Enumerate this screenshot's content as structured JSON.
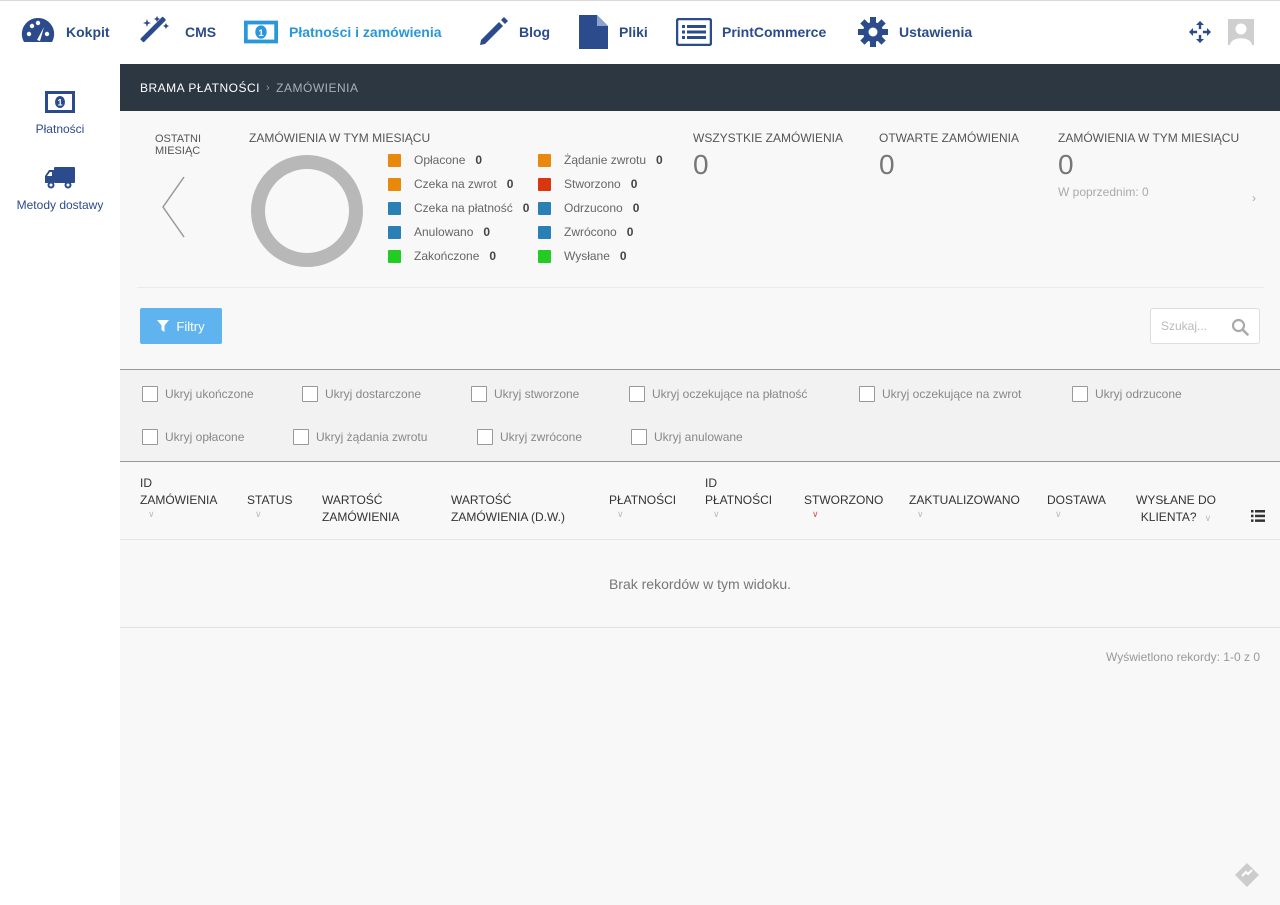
{
  "nav": {
    "items": [
      {
        "label": "Kokpit",
        "icon": "dashboard-gauge-icon"
      },
      {
        "label": "CMS",
        "icon": "magic-wand-icon"
      },
      {
        "label": "Płatności i zamówienia",
        "icon": "money-bill-icon"
      },
      {
        "label": "Blog",
        "icon": "pencil-icon"
      },
      {
        "label": "Pliki",
        "icon": "file-icon"
      },
      {
        "label": "PrintCommerce",
        "icon": "list-alt-icon"
      },
      {
        "label": "Ustawienia",
        "icon": "gear-icon"
      }
    ],
    "active_index": 2
  },
  "sidebar": {
    "items": [
      {
        "label": "Płatności",
        "icon": "money-bill-icon"
      },
      {
        "label": "Metody dostawy",
        "icon": "truck-icon"
      }
    ]
  },
  "breadcrumb": {
    "parent": "BRAMA PŁATNOŚCI",
    "current": "ZAMÓWIENIA"
  },
  "stats": {
    "period_label": "OSTATNI MIESIĄC",
    "chart_title": "ZAMÓWIENIA W TYM MIESIĄCU",
    "legend": [
      {
        "label": "Opłacone",
        "value": "0",
        "color": "#e8890c"
      },
      {
        "label": "Czeka na zwrot",
        "value": "0",
        "color": "#e8890c"
      },
      {
        "label": "Czeka na płatność",
        "value": "0",
        "color": "#2a7fb5"
      },
      {
        "label": "Anulowano",
        "value": "0",
        "color": "#2a7fb5"
      },
      {
        "label": "Zakończone",
        "value": "0",
        "color": "#22cc22"
      },
      {
        "label": "Żądanie zwrotu",
        "value": "0",
        "color": "#e8890c"
      },
      {
        "label": "Stworzono",
        "value": "0",
        "color": "#d9360f"
      },
      {
        "label": "Odrzucono",
        "value": "0",
        "color": "#2a7fb5"
      },
      {
        "label": "Zwrócono",
        "value": "0",
        "color": "#2a7fb5"
      },
      {
        "label": "Wysłane",
        "value": "0",
        "color": "#22cc22"
      }
    ],
    "all_orders": {
      "label": "WSZYSTKIE ZAMÓWIENIA",
      "value": "0"
    },
    "open_orders": {
      "label": "OTWARTE ZAMÓWIENIA",
      "value": "0"
    },
    "month_orders": {
      "label": "ZAMÓWIENIA W TYM MIESIĄCU",
      "value": "0",
      "previous": "W poprzednim: 0"
    }
  },
  "toolbar": {
    "filters_label": "Filtry",
    "search_placeholder": "Szukaj..."
  },
  "checkboxes": [
    "Ukryj ukończone",
    "Ukryj dostarczone",
    "Ukryj stworzone",
    "Ukryj oczekujące na płatność",
    "Ukryj oczekujące na zwrot",
    "Ukryj odrzucone",
    "Ukryj opłacone",
    "Ukryj żądania zwrotu",
    "Ukryj zwrócone",
    "Ukryj anulowane"
  ],
  "table": {
    "columns": [
      {
        "line1": "ID",
        "line2": "ZAMÓWIENIA"
      },
      {
        "line1": "",
        "line2": "STATUS"
      },
      {
        "line1": "",
        "line2": "WARTOŚĆ",
        "line3": "ZAMÓWIENIA"
      },
      {
        "line1": "",
        "line2": "WARTOŚĆ",
        "line3": "ZAMÓWIENIA (D.W.)"
      },
      {
        "line1": "",
        "line2": "PŁATNOŚCI"
      },
      {
        "line1": "ID",
        "line2": "PŁATNOŚCI"
      },
      {
        "line1": "",
        "line2": "STWORZONO"
      },
      {
        "line1": "",
        "line2": "ZAKTUALIZOWANO"
      },
      {
        "line1": "",
        "line2": "DOSTAWA"
      },
      {
        "line1": "",
        "line2": "WYSŁANE DO",
        "line3": "KLIENTA?"
      }
    ],
    "empty_message": "Brak rekordów w tym widoku.",
    "records_info": "Wyświetlono rekordy: 1-0 z 0"
  }
}
